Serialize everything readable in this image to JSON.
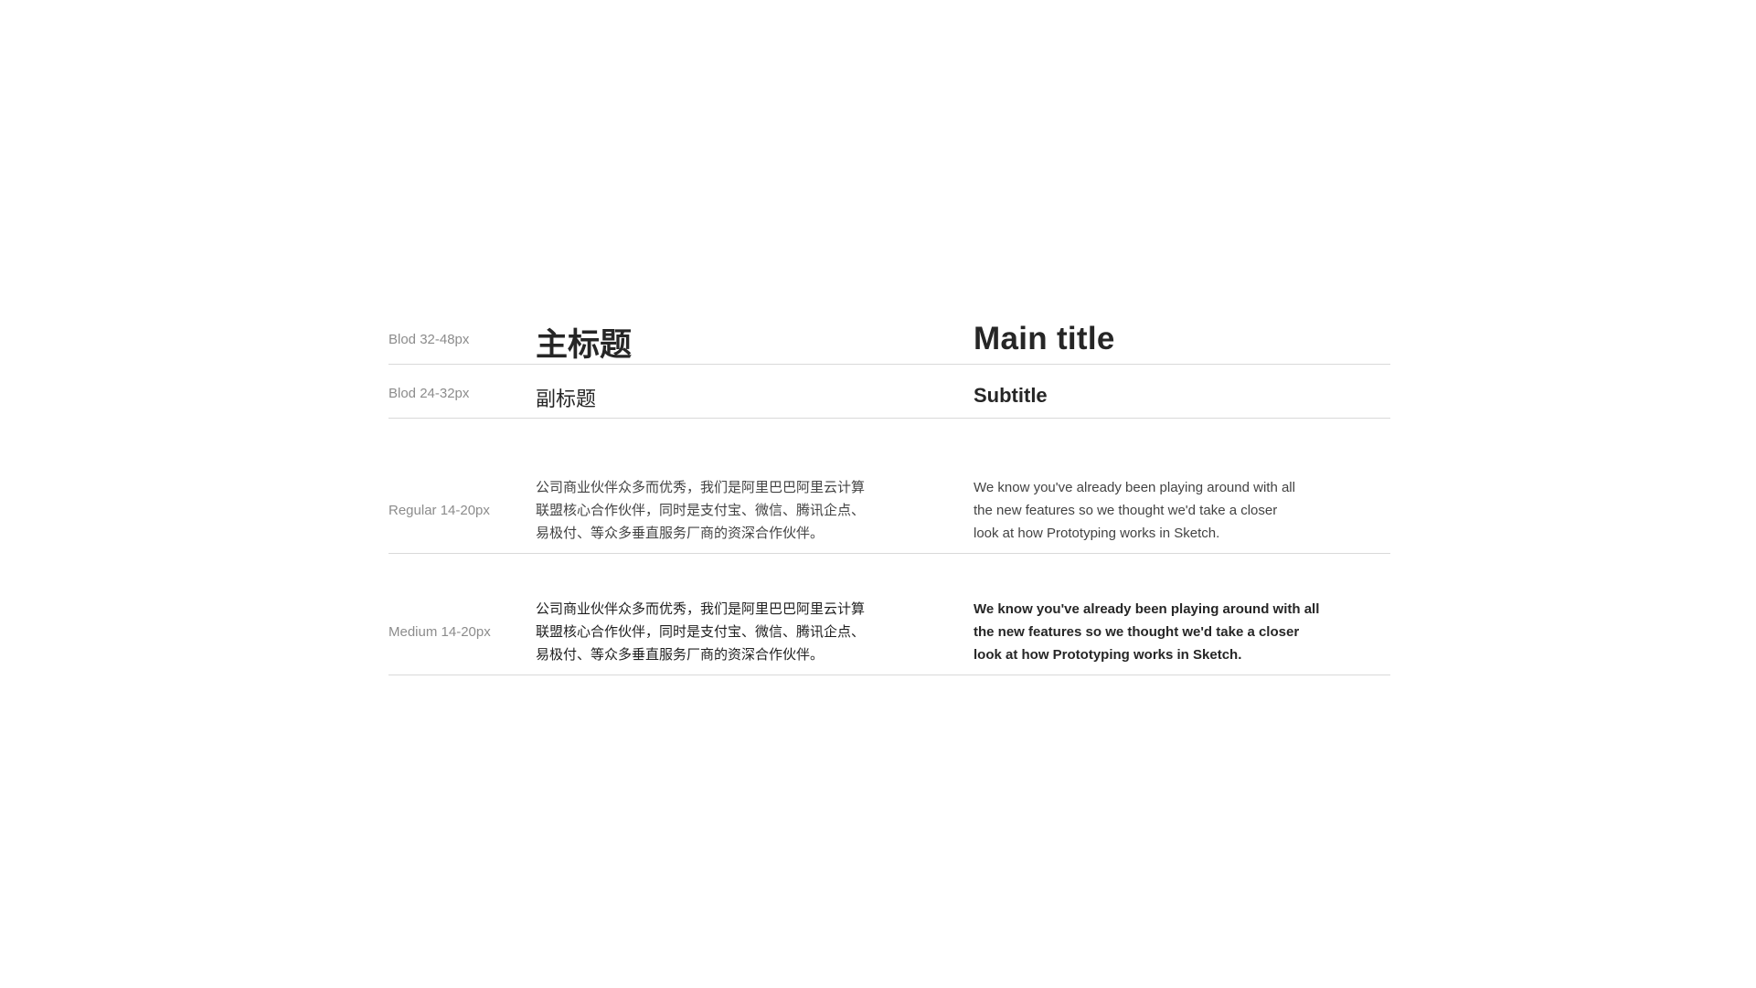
{
  "rows": [
    {
      "label": "Blod 32-48px",
      "cn": "主标题",
      "en": "Main title"
    },
    {
      "label": "Blod 24-32px",
      "cn": "副标题",
      "en": "Subtitle"
    },
    {
      "label": "Regular 14-20px",
      "cn_lines": [
        "公司商业伙伴众多而优秀，我们是阿里巴巴阿里云计算",
        "联盟核心合作伙伴，同时是支付宝、微信、腾讯企点、",
        "易极付、等众多垂直服务厂商的资深合作伙伴。"
      ],
      "en_lines": [
        "We know you've already been playing around with all",
        "the new features so we thought we'd take a closer",
        "look at how Prototyping works in Sketch."
      ]
    },
    {
      "label": "Medium 14-20px",
      "cn_lines": [
        "公司商业伙伴众多而优秀，我们是阿里巴巴阿里云计算",
        "联盟核心合作伙伴，同时是支付宝、微信、腾讯企点、",
        "易极付、等众多垂直服务厂商的资深合作伙伴。"
      ],
      "en_lines": [
        "We know you've already been playing around with all",
        "the new features so we thought we'd take a closer",
        "look at how Prototyping works in Sketch."
      ]
    }
  ],
  "colors": {
    "label": "#8c8c8c",
    "text_dark": "#262626",
    "text_regular": "#434343",
    "divider": "#d9d9d9"
  }
}
